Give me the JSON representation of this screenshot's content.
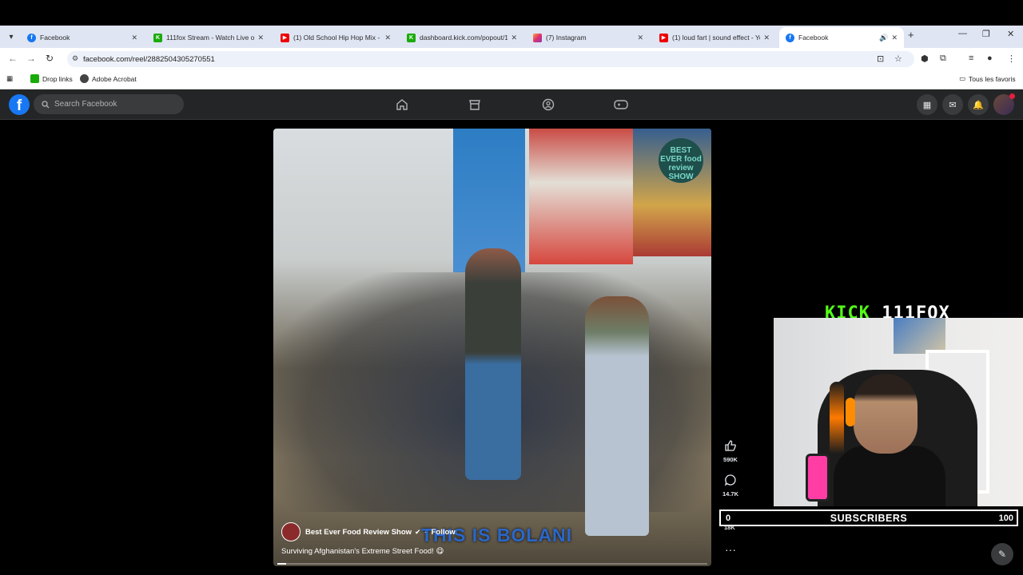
{
  "browser": {
    "tabs": [
      {
        "title": "Facebook",
        "favicon": "facebook-icon",
        "active": false
      },
      {
        "title": "111fox Stream - Watch Live on",
        "favicon": "kick-icon",
        "active": false
      },
      {
        "title": "(1) Old School Hip Hop Mix - S",
        "favicon": "youtube-icon",
        "active": false
      },
      {
        "title": "dashboard.kick.com/popout/11",
        "favicon": "kick-icon",
        "active": false
      },
      {
        "title": "(7) Instagram",
        "favicon": "instagram-icon",
        "active": false
      },
      {
        "title": "(1) loud fart | sound effect - Yo",
        "favicon": "youtube-icon",
        "active": false
      },
      {
        "title": "Facebook",
        "favicon": "facebook-icon",
        "active": true
      }
    ],
    "url": "facebook.com/reel/2882504305270551",
    "bookmarks": [
      {
        "label": "Drop links",
        "icon": "kick-icon"
      },
      {
        "label": "Adobe Acrobat",
        "icon": "acrobat-icon"
      }
    ],
    "all_bookmarks_label": "Tous les favoris"
  },
  "facebook": {
    "search_placeholder": "Search Facebook",
    "logo": "f"
  },
  "reel": {
    "channel_name": "Best Ever Food Review Show",
    "follow_label": "Follow",
    "title": "Surviving Afghanistan's Extreme Street Food! 😋",
    "overlay_caption": "THIS IS BOLANI",
    "watermark": "BEST EVER food review SHOW",
    "progress": 0.02,
    "likes": "590K",
    "comments": "14.7K",
    "shares": "18K"
  },
  "stream_overlay": {
    "kick_brand": "KICK",
    "channel": "111FOX",
    "subs_current": "0",
    "subs_label": "SUBSCRIBERS",
    "subs_goal": "100"
  },
  "colors": {
    "facebook_blue": "#1877f2",
    "kick_green": "#53fc18",
    "fb_dark": "#242526"
  }
}
